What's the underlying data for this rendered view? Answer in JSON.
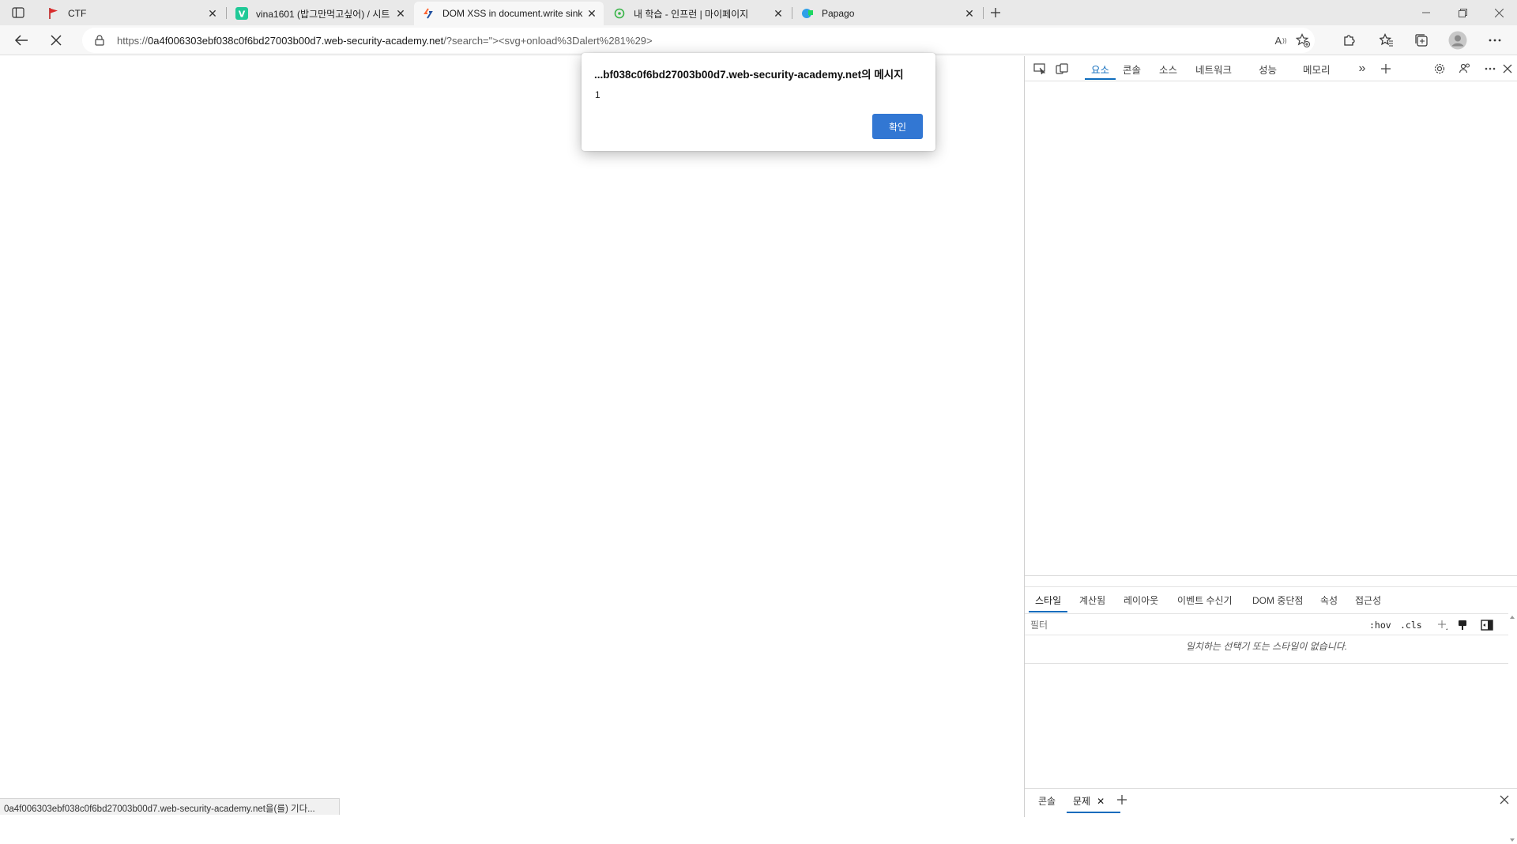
{
  "browser": {
    "tabs": [
      {
        "title": "CTF",
        "favicon": "red-flag-icon",
        "active": false
      },
      {
        "title": "vina1601 (밥그만먹고싶어) / 시트",
        "favicon": "velog-v-icon",
        "active": false
      },
      {
        "title": "DOM XSS in document.write sink",
        "favicon": "web-security-academy-icon",
        "active": true
      },
      {
        "title": "내 학습 - 인프런 | 마이페이지",
        "favicon": "inflearn-icon",
        "active": false
      },
      {
        "title": "Papago",
        "favicon": "papago-icon",
        "active": false
      }
    ],
    "address": {
      "scheme": "https://",
      "host": "0a4f006303ebf038c0f6bd27003b00d7.web-security-academy.net",
      "path": "/?search=\"><svg+onload%3Dalert%281%29>"
    },
    "read_aloud_label": "A",
    "status_text": "0a4f006303ebf038c0f6bd27003b00d7.web-security-academy.net을(를) 기다..."
  },
  "dialog": {
    "title": "...bf038c0f6bd27003b00d7.web-security-academy.net의 메시지",
    "message": "1",
    "ok_label": "확인"
  },
  "devtools": {
    "main_tabs": [
      "요소",
      "콘솔",
      "소스",
      "네트워크",
      "성능",
      "메모리"
    ],
    "active_main_tab": "요소",
    "sub_tabs": [
      "스타일",
      "계산됨",
      "레이아웃",
      "이벤트 수신기",
      "DOM 중단점",
      "속성",
      "접근성"
    ],
    "active_sub_tab": "스타일",
    "filter_placeholder": "필터",
    "hov_label": ":hov",
    "cls_label": ".cls",
    "empty_styles": "일치하는 선택기 또는 스타일이 없습니다.",
    "drawer_tabs": [
      "콘솔",
      "문제"
    ],
    "active_drawer_tab": "문제"
  },
  "colors": {
    "accent": "#0f6cbd",
    "ok_button": "#3277d3",
    "tabstrip": "#e9e9e9",
    "toolbar": "#f7f7f7"
  }
}
